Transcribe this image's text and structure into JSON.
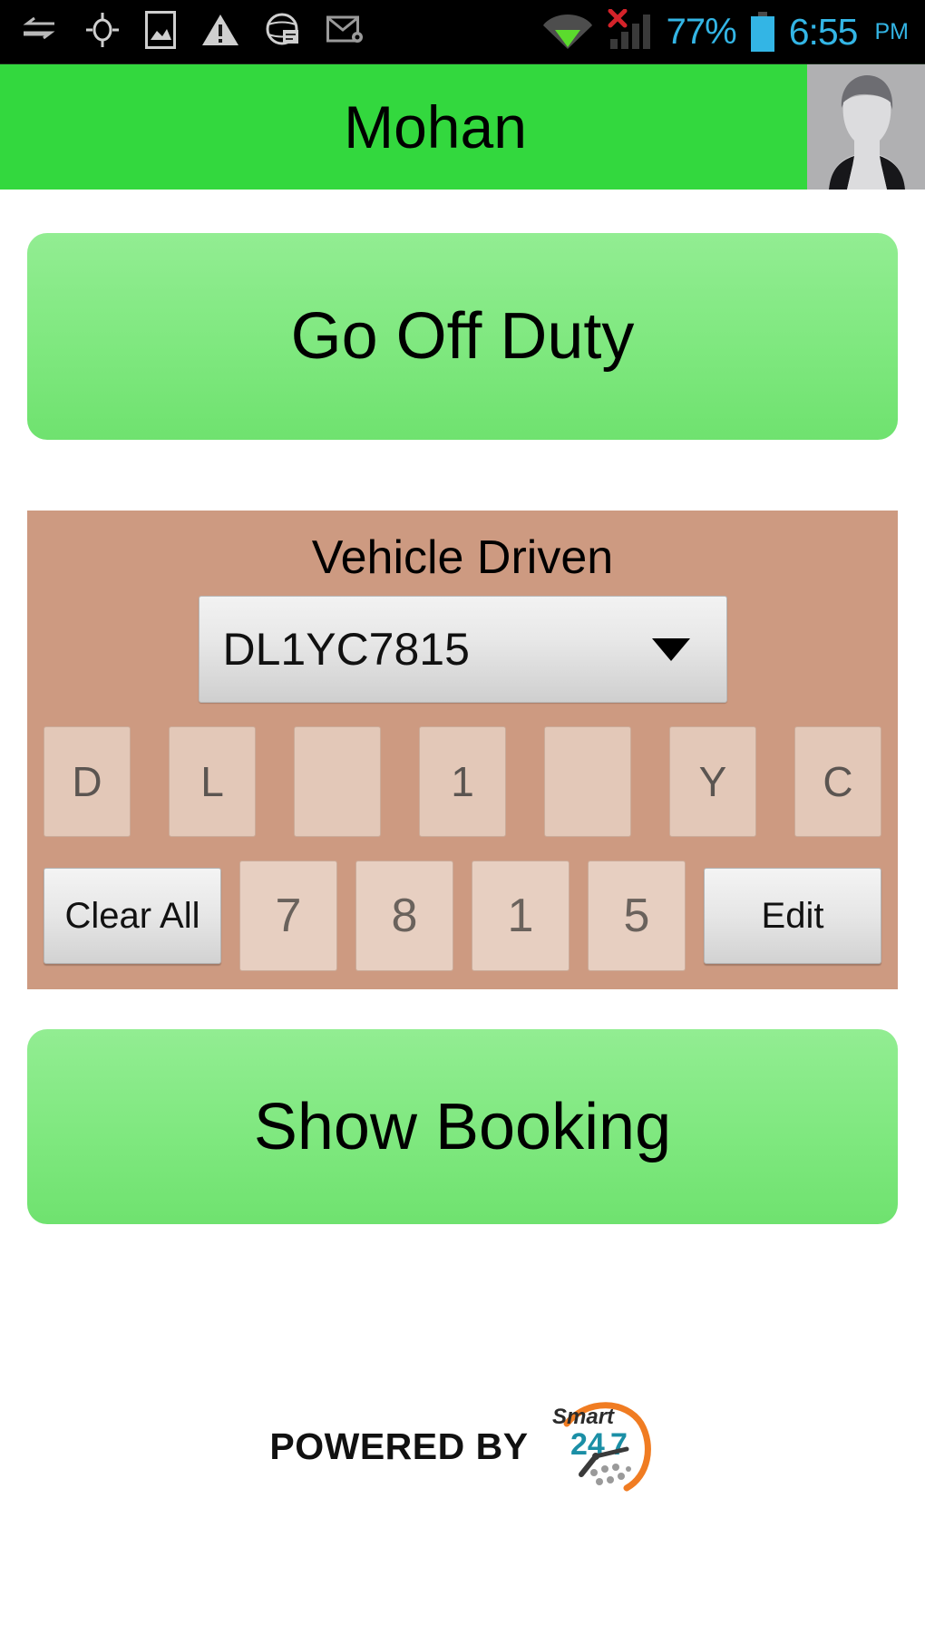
{
  "status_bar": {
    "icons": [
      {
        "name": "sync-arrows-icon"
      },
      {
        "name": "gps-location-icon"
      },
      {
        "name": "gallery-image-icon"
      },
      {
        "name": "warning-triangle-icon"
      },
      {
        "name": "browser-globe-icon"
      },
      {
        "name": "email-envelope-icon"
      },
      {
        "name": "wifi-icon"
      },
      {
        "name": "cellular-signal-no-service-icon"
      }
    ],
    "battery_percent": "77%",
    "battery_icon": "battery-icon",
    "time": "6:55",
    "ampm": "PM",
    "accent_color": "#33b5e5"
  },
  "app_bar": {
    "title": "Mohan",
    "avatar_name": "user-avatar",
    "background_color": "#33d83e"
  },
  "main": {
    "go_off_duty_label": "Go Off Duty",
    "show_booking_label": "Show Booking",
    "button_color": "#8ceb8c"
  },
  "vehicle_panel": {
    "title": "Vehicle Driven",
    "panel_color": "#cd9a81",
    "selected_vehicle": "DL1YC7815",
    "dropdown_icon": "chevron-down-icon",
    "letter_boxes": [
      "D",
      "L",
      "",
      "1",
      "",
      "Y",
      "C"
    ],
    "number_boxes": [
      "7",
      "8",
      "1",
      "5"
    ],
    "clear_all_label": "Clear All",
    "edit_label": "Edit"
  },
  "footer": {
    "powered_by": "POWERED BY",
    "logo_word": "Smart",
    "logo_number": "24 7",
    "logo_teal": "#1b8fa6",
    "logo_orange": "#f07c22"
  }
}
